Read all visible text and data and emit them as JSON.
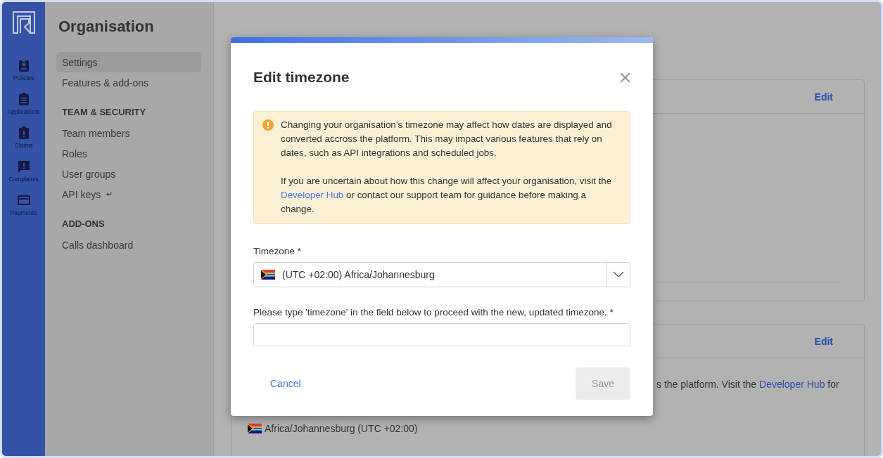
{
  "nav_rail": {
    "items": [
      {
        "label": "Policies",
        "kind": "badge"
      },
      {
        "label": "Applications",
        "kind": "clipboard"
      },
      {
        "label": "Claims",
        "kind": "alert-clipboard"
      },
      {
        "label": "Complaints",
        "kind": "chat"
      },
      {
        "label": "Payments",
        "kind": "card"
      }
    ]
  },
  "sidebar": {
    "title": "Organisation",
    "sections": [
      {
        "items": [
          {
            "label": "Settings",
            "selected": true
          },
          {
            "label": "Features & add-ons",
            "selected": false
          }
        ]
      },
      {
        "heading": "TEAM & SECURITY",
        "items": [
          {
            "label": "Team members",
            "selected": false
          },
          {
            "label": "Roles",
            "selected": false
          },
          {
            "label": "User groups",
            "selected": false
          },
          {
            "label": "API keys",
            "suffix": "↵",
            "selected": false
          }
        ]
      },
      {
        "heading": "ADD-ONS",
        "items": [
          {
            "label": "Calls dashboard",
            "selected": false
          }
        ]
      }
    ]
  },
  "cards": [
    {
      "action": "Edit"
    },
    {
      "action": "Edit",
      "text_before": "s the platform. Visit the",
      "link": "Developer Hub",
      "text_after": "for",
      "timezone": "Africa/Johannesburg (UTC +02:00)"
    }
  ],
  "modal": {
    "title": "Edit timezone",
    "close": "×",
    "alert": {
      "text": "Changing your organisation’s timezone may affect how dates are displayed and converted accross the platform. This may impact various features that rely on dates, such as API integrations and scheduled jobs.",
      "text_before": "If you are uncertain about how this change will affect your organisation, visit the",
      "link": "Developer Hub",
      "text_after": "or contact our support team for guidance before making a change."
    },
    "timezone_label": "Timezone *",
    "timezone_value": "(UTC +02:00) Africa/Johannesburg",
    "confirm_label": "Please type 'timezone' in the field below to proceed with the new, updated timezone. *",
    "cancel": "Cancel",
    "save": {
      "label": "Save",
      "disabled": true
    }
  }
}
